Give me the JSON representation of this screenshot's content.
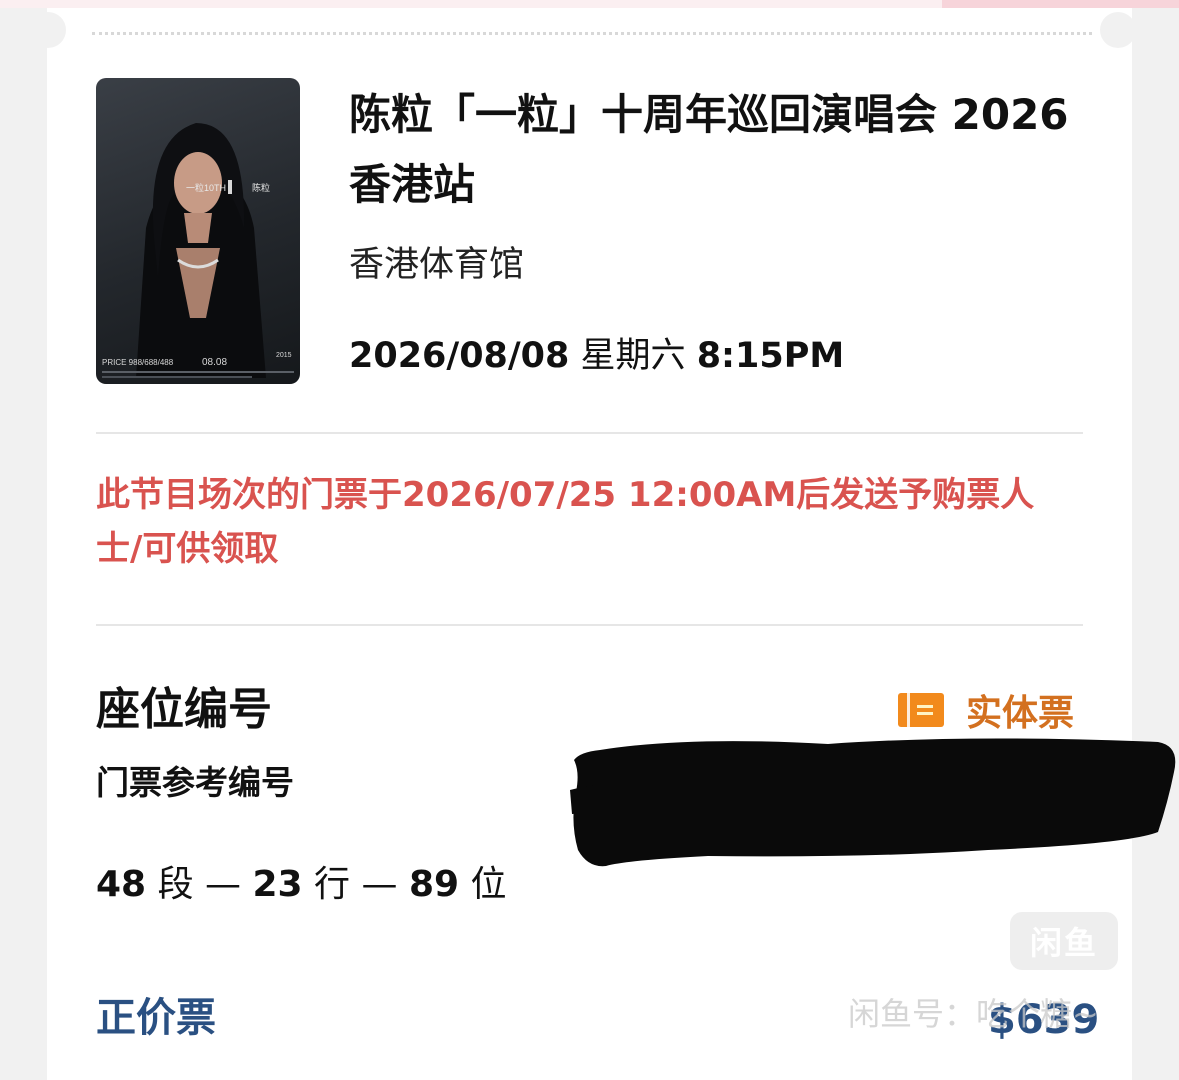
{
  "event": {
    "title": "陈粒「一粒」十周年巡回演唱会 2026 香港站",
    "venue": "香港体育馆",
    "date": "2026/08/08",
    "weekday": "星期六",
    "time": "8:15PM"
  },
  "notice": "此节目场次的门票于2026/07/25 12:00AM后发送予购票人士/可供领取",
  "seat_section": {
    "heading": "座位编号",
    "ticket_type": "实体票",
    "reference_label": "门票参考编号",
    "section_number": "48",
    "section_unit": "段",
    "row_number": "23",
    "row_unit": "行",
    "seat_number": "89",
    "seat_unit": "位",
    "separator": "—"
  },
  "price": {
    "type": "正价票",
    "amount": "$639"
  },
  "watermark": {
    "badge": "闲鱼",
    "text": "闲鱼号：吃个糖~"
  },
  "poster": {
    "text_lines": [
      "一粒10TH",
      "陈粒",
      "PRICE 988/688/488",
      "08.08",
      "2015"
    ]
  },
  "colors": {
    "notice": "#d9534f",
    "ticket_type": "#d3701f",
    "price": "#2a5082"
  }
}
